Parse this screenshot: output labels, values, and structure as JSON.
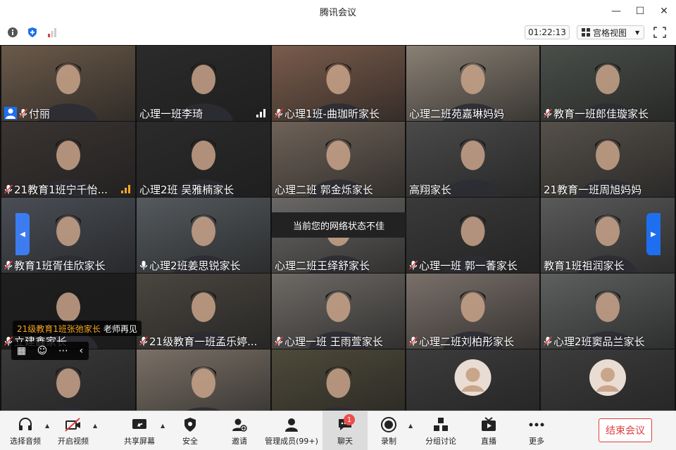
{
  "window": {
    "title": "腾讯会议"
  },
  "infobar": {
    "timer": "01:22:13",
    "view_label": "宫格视图"
  },
  "participants": [
    {
      "name": "付丽",
      "mic": "muted-host",
      "bg": "#6b5a4a"
    },
    {
      "name": "心理一班李琦",
      "mic": "none",
      "bg": "#2b2b2b",
      "signal": true
    },
    {
      "name": "心理1班-曲珈昕家长",
      "mic": "muted",
      "bg": "#7a5c4c"
    },
    {
      "name": "心理二班苑嘉琳妈妈",
      "mic": "none",
      "bg": "#8a8074"
    },
    {
      "name": "教育一班郎佳璇家长",
      "mic": "muted",
      "bg": "#4a4f4a"
    },
    {
      "name": "21教育1班宁千怡...",
      "mic": "muted",
      "bg": "#3a3432",
      "signal": true,
      "signal_color": "#f5a623"
    },
    {
      "name": "心理2班 吴雅楠家长",
      "mic": "none",
      "bg": "#2b2b2b"
    },
    {
      "name": "心理二班 郭金烁家长",
      "mic": "none",
      "bg": "#6e6258"
    },
    {
      "name": "高翔家长",
      "mic": "none",
      "bg": "#4a4a4a"
    },
    {
      "name": "21教育一班周旭妈妈",
      "mic": "none",
      "bg": "#55504a"
    },
    {
      "name": "教育1班胥佳欣家长",
      "mic": "muted",
      "bg": "#4a4e55"
    },
    {
      "name": "心理2班姜思锐家长",
      "mic": "on",
      "bg": "#555a5e"
    },
    {
      "name": "心理二班王绎舒家长",
      "mic": "none",
      "bg": "#6a6866"
    },
    {
      "name": "心理一班 郭一萫家长",
      "mic": "muted",
      "bg": "#3a3a3a"
    },
    {
      "name": "教育1班祖润家长",
      "mic": "none",
      "bg": "#5a5a5a"
    },
    {
      "name": "立建鑫家长",
      "mic": "muted",
      "bg": "#1e1e1e"
    },
    {
      "name": "21级教育一班孟乐婷...",
      "mic": "muted",
      "bg": "#4a4640"
    },
    {
      "name": "心理一班 王雨萱家长",
      "mic": "muted",
      "bg": "#6e6a66"
    },
    {
      "name": "心理二班刘柏彤家长",
      "mic": "muted",
      "bg": "#7a706a"
    },
    {
      "name": "心理2班窦品兰家长",
      "mic": "muted",
      "bg": "#5e6060"
    },
    {
      "name": "",
      "mic": "none",
      "bg": "#3a3a3a"
    },
    {
      "name": "",
      "mic": "none",
      "bg": "#7a7066"
    },
    {
      "name": "",
      "mic": "none",
      "bg": "#4e4a3a"
    },
    {
      "name": "",
      "mic": "none",
      "bg": "#3c3c3c",
      "avatar": true
    },
    {
      "name": "",
      "mic": "none",
      "bg": "#3c3c3c",
      "avatar": true
    }
  ],
  "overlays": {
    "network_tip": "当前您的网络状态不佳",
    "chat_sender": "21级教育1班张弛家长",
    "chat_message": "老师再见"
  },
  "toolbar": {
    "mic_label": "选择音频",
    "video_label": "开启视频",
    "share_label": "共享屏幕",
    "security_label": "安全",
    "invite_label": "邀请",
    "members_label": "管理成员(99+)",
    "chat_label": "聊天",
    "chat_badge": "1",
    "record_label": "录制",
    "breakout_label": "分组讨论",
    "live_label": "直播",
    "more_label": "更多",
    "end_label": "结束会议"
  },
  "colors": {
    "accent": "#1e6ff0",
    "danger": "#e03d3d",
    "active_speaker": "#1fb96a"
  }
}
